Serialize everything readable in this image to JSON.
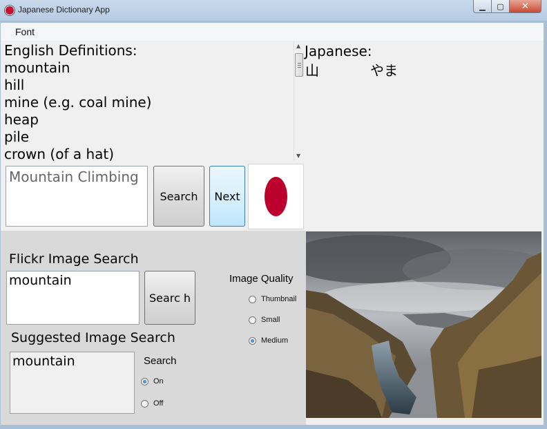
{
  "window": {
    "title": "Japanese Dictionary App"
  },
  "menu": {
    "items": [
      "Font"
    ]
  },
  "definitions": {
    "heading": "English Definitions:",
    "items": [
      "mountain",
      "hill",
      "mine (e.g. coal mine)",
      "heap",
      "pile",
      "crown (of a hat)"
    ]
  },
  "japanese": {
    "heading": "Japanese:",
    "kanji": "山",
    "kana": "やま"
  },
  "dictionary_search": {
    "value": "Mountain Climbing",
    "search_label": "Search",
    "next_label": "Next"
  },
  "flickr": {
    "heading": "Flickr Image Search",
    "value": "mountain",
    "search_label": "Searc h",
    "quality_heading": "Image Quality",
    "quality_options": [
      {
        "label": "Thumbnail",
        "selected": false
      },
      {
        "label": "Small",
        "selected": false
      },
      {
        "label": "Medium",
        "selected": true
      }
    ]
  },
  "suggested": {
    "heading": "Suggested Image Search",
    "value": "mountain",
    "search_heading": "Search",
    "options": [
      {
        "label": "On",
        "selected": true
      },
      {
        "label": "Off",
        "selected": false
      }
    ]
  },
  "colors": {
    "flag_red": "#bc002d",
    "app_icon": "#c8102e"
  },
  "icons": {
    "app": "japan-flag-icon",
    "minimize": "minimize-icon",
    "maximize": "maximize-icon",
    "close": "close-icon"
  }
}
